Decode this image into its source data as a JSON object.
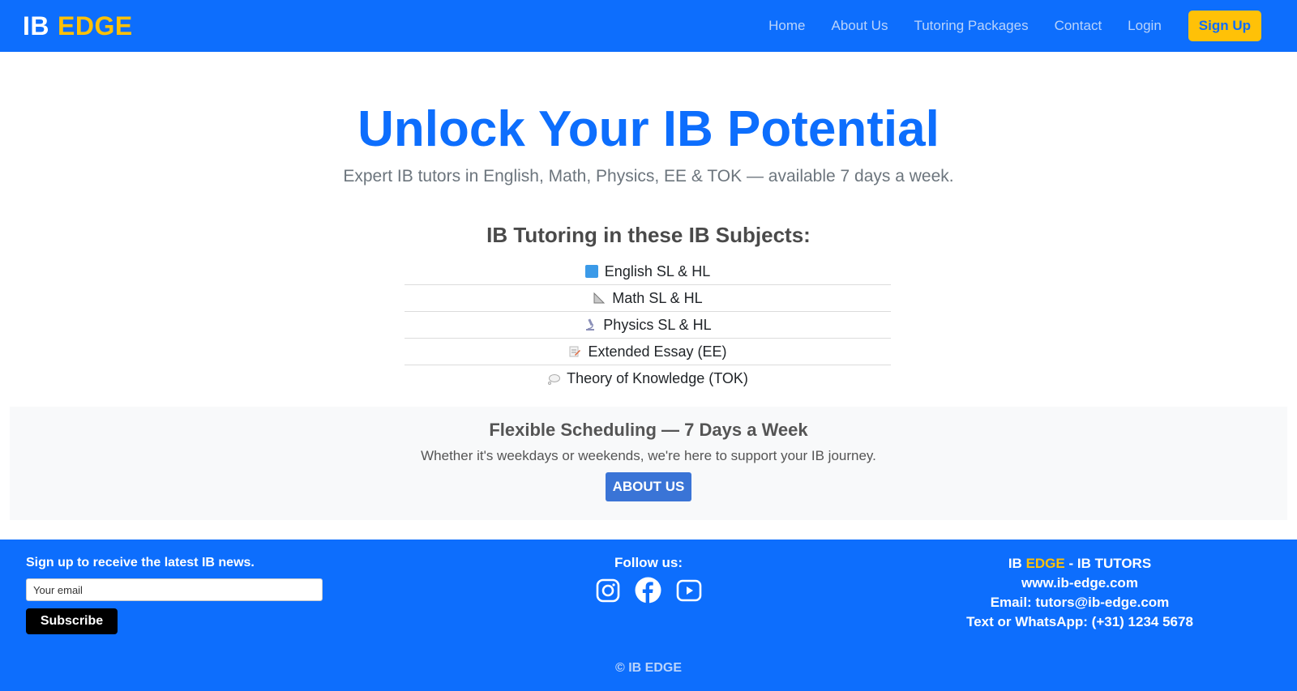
{
  "nav": {
    "brand_part1": "IB",
    "brand_part2": "EDGE",
    "links": [
      "Home",
      "About Us",
      "Tutoring Packages",
      "Contact",
      "Login"
    ],
    "signup_label": "Sign Up"
  },
  "hero": {
    "title": "Unlock Your IB Potential",
    "subtitle": "Expert IB tutors in English, Math, Physics, EE & TOK — available 7 days a week."
  },
  "subjects": {
    "heading": "IB Tutoring in these IB Subjects:",
    "items": [
      {
        "label": "English SL & HL",
        "icon": "blue-book-icon"
      },
      {
        "label": "Math SL & HL",
        "icon": "triangle-ruler-icon"
      },
      {
        "label": "Physics SL & HL",
        "icon": "microscope-icon"
      },
      {
        "label": "Extended Essay (EE)",
        "icon": "memo-icon"
      },
      {
        "label": "Theory of Knowledge (TOK)",
        "icon": "thought-bubble-icon"
      }
    ]
  },
  "scheduling": {
    "title": "Flexible Scheduling — 7 Days a Week",
    "text": "Whether it's weekdays or weekends, we're here to support your IB journey.",
    "button_label": "ABOUT US"
  },
  "footer": {
    "news_label": "Sign up to receive the latest IB news.",
    "email_placeholder": "Your email",
    "subscribe_label": "Subscribe",
    "follow_label": "Follow us:",
    "socials": [
      "instagram-icon",
      "facebook-icon",
      "youtube-icon"
    ],
    "contact_brand1": "IB ",
    "contact_brand2": "EDGE",
    "contact_brand3": " - IB TUTORS",
    "website": "www.ib-edge.com",
    "email": "Email: tutors@ib-edge.com",
    "phone": "Text or WhatsApp: (+31) 1234 5678",
    "copyright": "© IB EDGE"
  },
  "colors": {
    "primary": "#0d6efd",
    "accent": "#ffc107",
    "button": "#3a74d6"
  }
}
